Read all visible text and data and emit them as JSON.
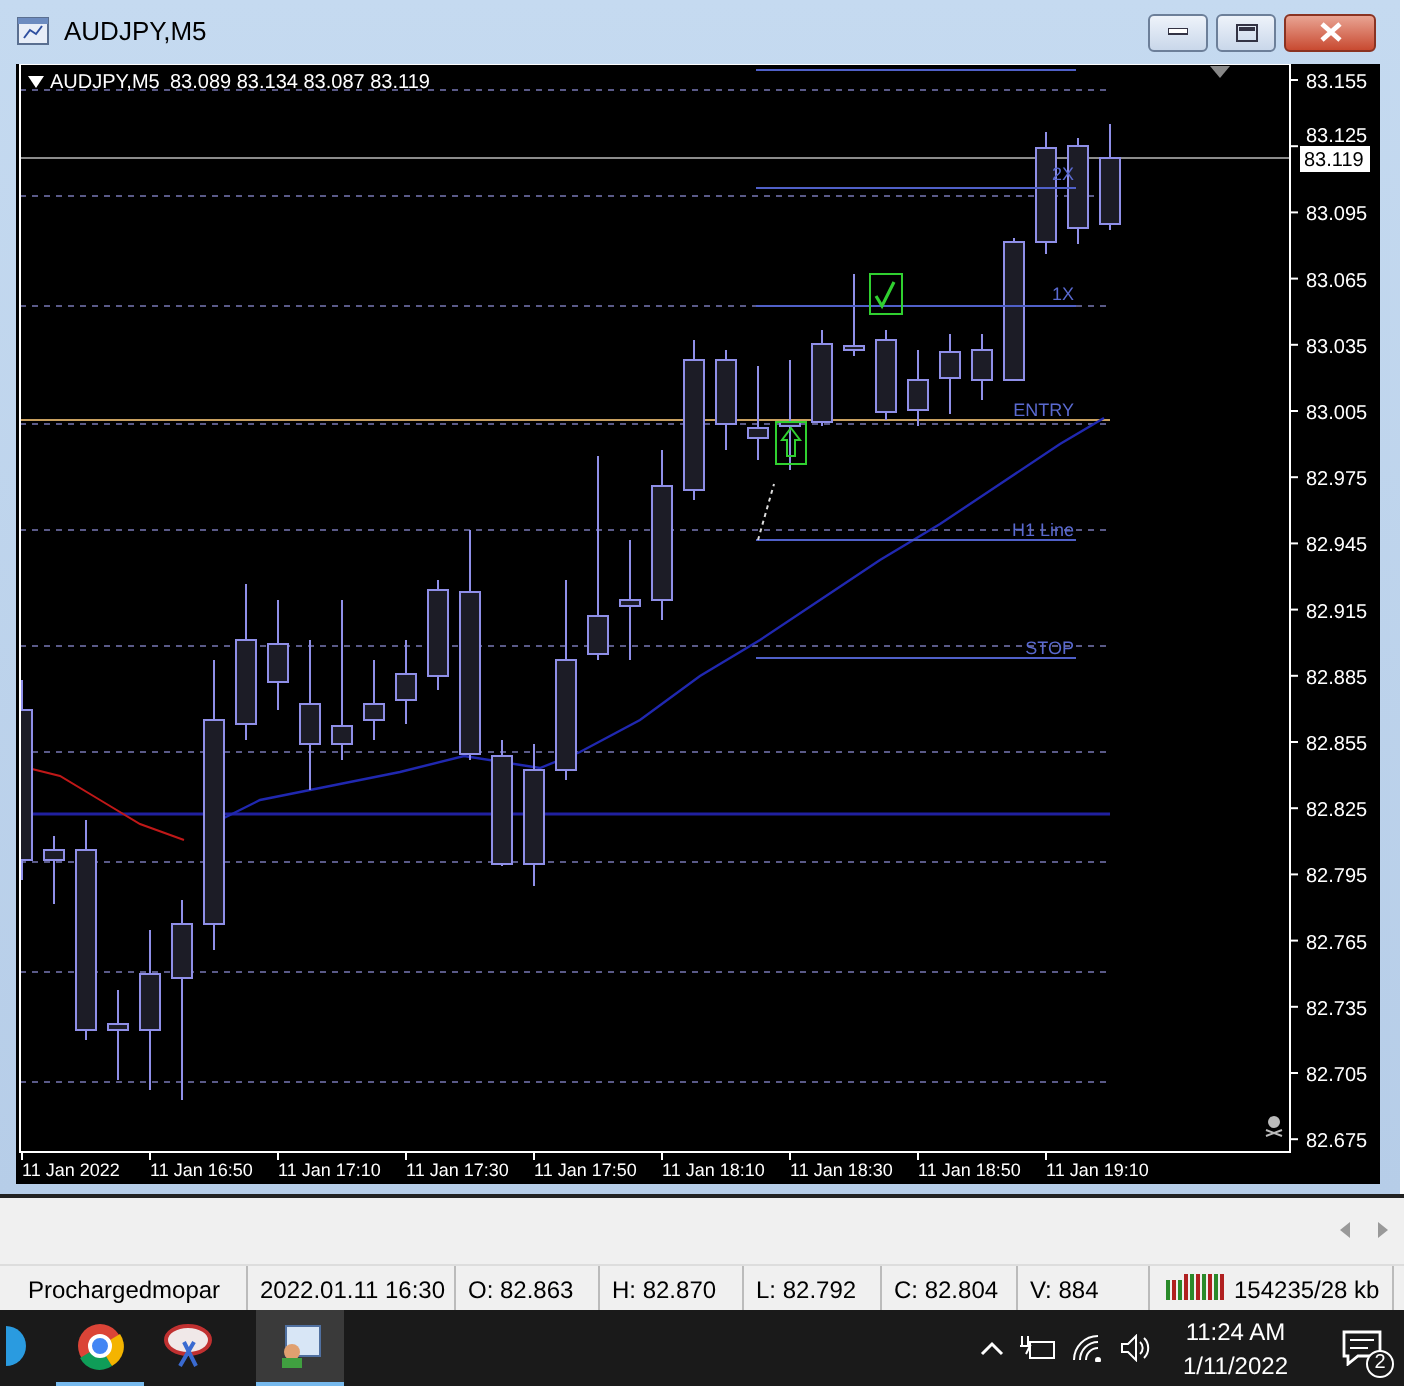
{
  "window": {
    "title": "AUDJPY,M5"
  },
  "chart": {
    "symbol": "AUDJPY,M5",
    "quotes": "83.089 83.134 83.087 83.119",
    "price_labels": [
      "83.155",
      "83.125",
      "83.095",
      "83.065",
      "83.035",
      "83.005",
      "82.975",
      "82.945",
      "82.915",
      "82.885",
      "82.855",
      "82.825",
      "82.795",
      "82.765",
      "82.735",
      "82.705",
      "82.675"
    ],
    "current_price": "83.119",
    "time_labels": [
      "11 Jan 2022",
      "11 Jan 16:50",
      "11 Jan 17:10",
      "11 Jan 17:30",
      "11 Jan 17:50",
      "11 Jan 18:10",
      "11 Jan 18:30",
      "11 Jan 18:50",
      "11 Jan 19:10"
    ],
    "levels": [
      "2X",
      "1X",
      "ENTRY",
      "H1 Line",
      "STOP"
    ]
  },
  "status_bar": [
    "Prochargedmopar",
    "2022.01.11 16:30",
    "O: 82.863",
    "H: 82.870",
    "L: 82.792",
    "C: 82.804",
    "V: 884"
  ],
  "traffic": "154235/28 kb",
  "taskbar": {
    "apps": [
      {
        "kind": "bluecircle",
        "running": false,
        "selected": false
      },
      {
        "kind": "browser",
        "running": true,
        "selected": false
      },
      {
        "kind": "snipping",
        "running": false,
        "selected": false
      },
      {
        "kind": "terminal",
        "running": true,
        "selected": true
      }
    ],
    "clock_time": "11:24 AM",
    "clock_date": "1/11/2022",
    "notification_count": "2"
  }
}
